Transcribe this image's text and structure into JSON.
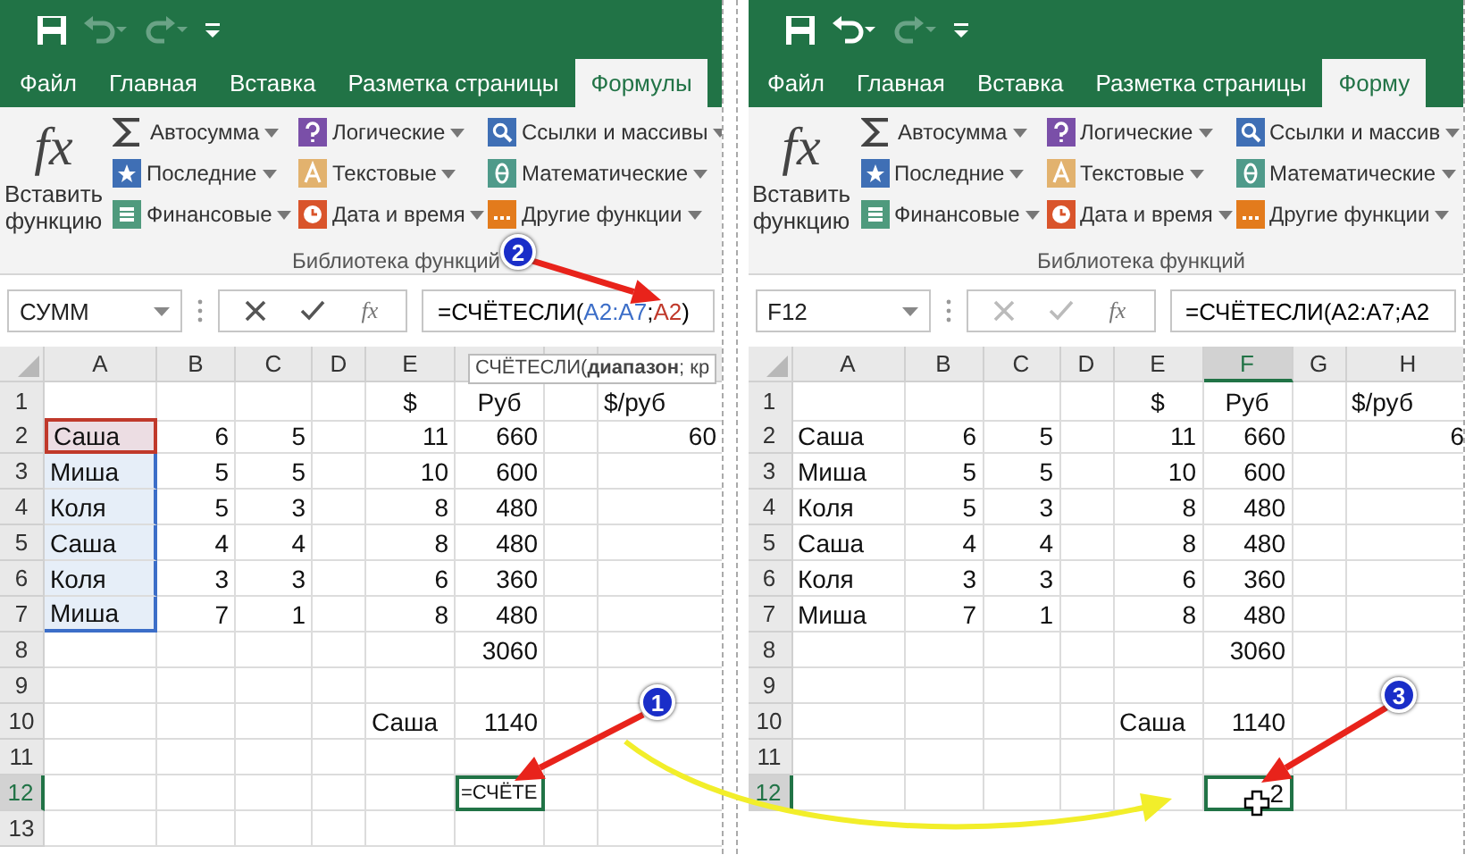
{
  "panels": [
    {
      "undo_enabled": false,
      "tabs": [
        {
          "label": "Файл",
          "selected": false
        },
        {
          "label": "Главная",
          "selected": false
        },
        {
          "label": "Вставка",
          "selected": false
        },
        {
          "label": "Разметка страницы",
          "selected": false
        },
        {
          "label": "Формулы",
          "selected": true
        }
      ],
      "ribbon": {
        "insert_function": {
          "symbol": "fx",
          "label": "Вставить функцию"
        },
        "columns": [
          [
            {
              "label": "Автосумма",
              "kind": "autosum"
            },
            {
              "label": "Последние",
              "kind": "recent"
            },
            {
              "label": "Финансовые",
              "kind": "financial"
            }
          ],
          [
            {
              "label": "Логические",
              "kind": "logical"
            },
            {
              "label": "Текстовые",
              "kind": "text"
            },
            {
              "label": "Дата и время",
              "kind": "datetime"
            }
          ],
          [
            {
              "label": "Ссылки и массивы",
              "kind": "lookup"
            },
            {
              "label": "Математические",
              "kind": "math"
            },
            {
              "label": "Другие функции",
              "kind": "more"
            }
          ]
        ],
        "group_label": "Библиотека функций"
      },
      "formula_bar": {
        "name_box": "СУММ",
        "editing": true,
        "fx": "fx",
        "formula": [
          {
            "text": "=СЧЁТЕСЛИ(",
            "color": "#000000"
          },
          {
            "text": "A2:A7",
            "color": "#3c6ec8"
          },
          {
            "text": ";",
            "color": "#000000"
          },
          {
            "text": "A2",
            "color": "#c0392b"
          },
          {
            "text": ")",
            "color": "#000000"
          }
        ]
      },
      "tooltip": "СЧЁТЕСЛИ(**диапазон**; кр",
      "column_headers": [
        {
          "label": "A",
          "selected": false
        },
        {
          "label": "B",
          "selected": false
        },
        {
          "label": "C",
          "selected": false
        },
        {
          "label": "D",
          "selected": false
        },
        {
          "label": "E",
          "selected": false
        }
      ],
      "rows": [
        {
          "num": "1",
          "selected": false,
          "cells": [
            null,
            null,
            null,
            null,
            {
              "text": "$",
              "kind": "header",
              "selected": false
            },
            {
              "text": "Руб",
              "kind": "header",
              "selected": false
            },
            null,
            {
              "text": "$/руб",
              "kind": "text",
              "selected": false
            }
          ]
        },
        {
          "num": "2",
          "selected": false,
          "cells": [
            {
              "text": "Саша",
              "kind": "text",
              "selected": false,
              "in_range": true,
              "criteria": true
            },
            {
              "text": "6",
              "kind": "number",
              "selected": false
            },
            {
              "text": "5",
              "kind": "number",
              "selected": false
            },
            null,
            {
              "text": "11",
              "kind": "number",
              "selected": false
            },
            {
              "text": "660",
              "kind": "number",
              "selected": false
            },
            null,
            {
              "text": "60",
              "kind": "number",
              "selected": false
            }
          ]
        },
        {
          "num": "3",
          "selected": false,
          "cells": [
            {
              "text": "Миша",
              "kind": "text",
              "selected": false,
              "in_range": true,
              "criteria": false
            },
            {
              "text": "5",
              "kind": "number",
              "selected": false
            },
            {
              "text": "5",
              "kind": "number",
              "selected": false
            },
            null,
            {
              "text": "10",
              "kind": "number",
              "selected": false
            },
            {
              "text": "600",
              "kind": "number",
              "selected": false
            }
          ]
        },
        {
          "num": "4",
          "selected": false,
          "cells": [
            {
              "text": "Коля",
              "kind": "text",
              "selected": false,
              "in_range": true,
              "criteria": false
            },
            {
              "text": "5",
              "kind": "number",
              "selected": false
            },
            {
              "text": "3",
              "kind": "number",
              "selected": false
            },
            null,
            {
              "text": "8",
              "kind": "number",
              "selected": false
            },
            {
              "text": "480",
              "kind": "number",
              "selected": false
            }
          ]
        },
        {
          "num": "5",
          "selected": false,
          "cells": [
            {
              "text": "Саша",
              "kind": "text",
              "selected": false,
              "in_range": true,
              "criteria": false
            },
            {
              "text": "4",
              "kind": "number",
              "selected": false
            },
            {
              "text": "4",
              "kind": "number",
              "selected": false
            },
            null,
            {
              "text": "8",
              "kind": "number",
              "selected": false
            },
            {
              "text": "480",
              "kind": "number",
              "selected": false
            }
          ]
        },
        {
          "num": "6",
          "selected": false,
          "cells": [
            {
              "text": "Коля",
              "kind": "text",
              "selected": false,
              "in_range": true,
              "criteria": false
            },
            {
              "text": "3",
              "kind": "number",
              "selected": false
            },
            {
              "text": "3",
              "kind": "number",
              "selected": false
            },
            null,
            {
              "text": "6",
              "kind": "number",
              "selected": false
            },
            {
              "text": "360",
              "kind": "number",
              "selected": false
            }
          ]
        },
        {
          "num": "7",
          "selected": false,
          "cells": [
            {
              "text": "Миша",
              "kind": "text",
              "selected": false,
              "in_range": true,
              "criteria": false
            },
            {
              "text": "7",
              "kind": "number",
              "selected": false
            },
            {
              "text": "1",
              "kind": "number",
              "selected": false
            },
            null,
            {
              "text": "8",
              "kind": "number",
              "selected": false
            },
            {
              "text": "480",
              "kind": "number",
              "selected": false
            }
          ]
        },
        {
          "num": "8",
          "selected": false,
          "cells": [
            null,
            null,
            null,
            null,
            null,
            {
              "text": "3060",
              "kind": "number",
              "selected": false
            }
          ]
        },
        {
          "num": "9",
          "selected": false,
          "cells": []
        },
        {
          "num": "10",
          "selected": false,
          "cells": [
            null,
            null,
            null,
            null,
            {
              "text": "Саша",
              "kind": "text",
              "selected": false
            },
            {
              "text": "1140",
              "kind": "number",
              "selected": false
            }
          ]
        },
        {
          "num": "11",
          "selected": false,
          "cells": []
        },
        {
          "num": "12",
          "selected": true,
          "cells": [
            null,
            null,
            null,
            null,
            null,
            {
              "text": "=СЧЁТЕ",
              "kind": "text",
              "selected": true
            }
          ]
        },
        {
          "num": "13",
          "selected": false,
          "cells": []
        }
      ]
    },
    {
      "undo_enabled": true,
      "tabs": [
        {
          "label": "Файл",
          "selected": false
        },
        {
          "label": "Главная",
          "selected": false
        },
        {
          "label": "Вставка",
          "selected": false
        },
        {
          "label": "Разметка страницы",
          "selected": false
        },
        {
          "label": "Форму",
          "selected": true
        }
      ],
      "ribbon": {
        "insert_function": {
          "symbol": "fx",
          "label": "Вставить функцию"
        },
        "columns": [
          [
            {
              "label": "Автосумма",
              "kind": "autosum"
            },
            {
              "label": "Последние",
              "kind": "recent"
            },
            {
              "label": "Финансовые",
              "kind": "financial"
            }
          ],
          [
            {
              "label": "Логические",
              "kind": "logical"
            },
            {
              "label": "Текстовые",
              "kind": "text"
            },
            {
              "label": "Дата и время",
              "kind": "datetime"
            }
          ],
          [
            {
              "label": "Ссылки и массив",
              "kind": "lookup"
            },
            {
              "label": "Математические",
              "kind": "math"
            },
            {
              "label": "Другие функции",
              "kind": "more"
            }
          ]
        ],
        "group_label": "Библиотека функций"
      },
      "formula_bar": {
        "name_box": "F12",
        "editing": false,
        "fx": "fx",
        "formula": [
          {
            "text": "=СЧЁТЕСЛИ(A2:A7;A2",
            "color": "#000000"
          }
        ]
      },
      "column_headers": [
        {
          "label": "A",
          "selected": false
        },
        {
          "label": "B",
          "selected": false
        },
        {
          "label": "C",
          "selected": false
        },
        {
          "label": "D",
          "selected": false
        },
        {
          "label": "E",
          "selected": false
        },
        {
          "label": "F",
          "selected": true
        },
        {
          "label": "G",
          "selected": false
        },
        {
          "label": "H",
          "selected": false
        }
      ],
      "rows": [
        {
          "num": "1",
          "selected": false,
          "cells": [
            null,
            null,
            null,
            null,
            {
              "text": "$",
              "kind": "header",
              "selected": false
            },
            {
              "text": "Руб",
              "kind": "header",
              "selected": false
            },
            null,
            {
              "text": "$/руб",
              "kind": "text",
              "selected": false
            }
          ]
        },
        {
          "num": "2",
          "selected": false,
          "cells": [
            {
              "text": "Саша",
              "kind": "text",
              "selected": false
            },
            {
              "text": "6",
              "kind": "number",
              "selected": false
            },
            {
              "text": "5",
              "kind": "number",
              "selected": false
            },
            null,
            {
              "text": "11",
              "kind": "number",
              "selected": false
            },
            {
              "text": "660",
              "kind": "number",
              "selected": false
            },
            null,
            {
              "text": "6",
              "kind": "number",
              "selected": false
            }
          ]
        },
        {
          "num": "3",
          "selected": false,
          "cells": [
            {
              "text": "Миша",
              "kind": "text",
              "selected": false
            },
            {
              "text": "5",
              "kind": "number",
              "selected": false
            },
            {
              "text": "5",
              "kind": "number",
              "selected": false
            },
            null,
            {
              "text": "10",
              "kind": "number",
              "selected": false
            },
            {
              "text": "600",
              "kind": "number",
              "selected": false
            }
          ]
        },
        {
          "num": "4",
          "selected": false,
          "cells": [
            {
              "text": "Коля",
              "kind": "text",
              "selected": false
            },
            {
              "text": "5",
              "kind": "number",
              "selected": false
            },
            {
              "text": "3",
              "kind": "number",
              "selected": false
            },
            null,
            {
              "text": "8",
              "kind": "number",
              "selected": false
            },
            {
              "text": "480",
              "kind": "number",
              "selected": false
            }
          ]
        },
        {
          "num": "5",
          "selected": false,
          "cells": [
            {
              "text": "Саша",
              "kind": "text",
              "selected": false
            },
            {
              "text": "4",
              "kind": "number",
              "selected": false
            },
            {
              "text": "4",
              "kind": "number",
              "selected": false
            },
            null,
            {
              "text": "8",
              "kind": "number",
              "selected": false
            },
            {
              "text": "480",
              "kind": "number",
              "selected": false
            }
          ]
        },
        {
          "num": "6",
          "selected": false,
          "cells": [
            {
              "text": "Коля",
              "kind": "text",
              "selected": false
            },
            {
              "text": "3",
              "kind": "number",
              "selected": false
            },
            {
              "text": "3",
              "kind": "number",
              "selected": false
            },
            null,
            {
              "text": "6",
              "kind": "number",
              "selected": false
            },
            {
              "text": "360",
              "kind": "number",
              "selected": false
            }
          ]
        },
        {
          "num": "7",
          "selected": false,
          "cells": [
            {
              "text": "Миша",
              "kind": "text",
              "selected": false
            },
            {
              "text": "7",
              "kind": "number",
              "selected": false
            },
            {
              "text": "1",
              "kind": "number",
              "selected": false
            },
            null,
            {
              "text": "8",
              "kind": "number",
              "selected": false
            },
            {
              "text": "480",
              "kind": "number",
              "selected": false
            }
          ]
        },
        {
          "num": "8",
          "selected": false,
          "cells": [
            null,
            null,
            null,
            null,
            null,
            {
              "text": "3060",
              "kind": "number",
              "selected": false
            }
          ]
        },
        {
          "num": "9",
          "selected": false,
          "cells": []
        },
        {
          "num": "10",
          "selected": false,
          "cells": [
            null,
            null,
            null,
            null,
            {
              "text": "Саша",
              "kind": "text",
              "selected": false
            },
            {
              "text": "1140",
              "kind": "number",
              "selected": false
            }
          ]
        },
        {
          "num": "11",
          "selected": false,
          "cells": []
        },
        {
          "num": "12",
          "selected": true,
          "cells": [
            null,
            null,
            null,
            null,
            null,
            {
              "text": "2",
              "kind": "number",
              "selected": true
            }
          ]
        }
      ]
    }
  ],
  "annotations": [
    {
      "label": "1"
    },
    {
      "label": "2"
    },
    {
      "label": "3"
    }
  ]
}
